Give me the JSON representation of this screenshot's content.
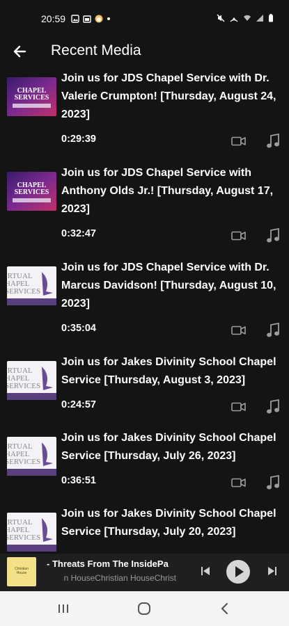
{
  "status": {
    "time": "20:59"
  },
  "header": {
    "title": "Recent Media",
    "back_icon": "arrow-left-icon"
  },
  "colors": {
    "background": "#141414",
    "icon_gray": "#9c9c9c",
    "player_bg": "#1f1f1f",
    "nav_bg": "#f4f4f4"
  },
  "items": [
    {
      "title": "Join us for JDS Chapel Service with Dr.\nValerie Crumpton! [Thursday, August 24,\n2023]",
      "duration": "0:29:39",
      "thumb_text": [
        "CHAPEL",
        "SERVICES"
      ],
      "thumb_style": "purple"
    },
    {
      "title": "Join us for JDS Chapel Service with\nAnthony Olds Jr.! [Thursday, August 17,\n2023]",
      "duration": "0:32:47",
      "thumb_text": [
        "CHAPEL",
        "SERVICES"
      ],
      "thumb_style": "purple"
    },
    {
      "title": "Join us for JDS Chapel Service with Dr.\nMarcus Davidson! [Thursday, August 10,\n2023]",
      "duration": "0:35:04",
      "thumb_text": [
        "IRTUAL",
        "HAPEL",
        "SERVICES"
      ],
      "thumb_style": "white"
    },
    {
      "title": "Join us for Jakes Divinity School Chapel\nService [Thursday, August 3, 2023]",
      "duration": "0:24:57",
      "thumb_text": [
        "IRTUAL",
        "HAPEL",
        "SERVICES"
      ],
      "thumb_style": "white"
    },
    {
      "title": "Join us for Jakes Divinity School Chapel\nService [Thursday, July 26, 2023]",
      "duration": "0:36:51",
      "thumb_text": [
        "IRTUAL",
        "HAPEL",
        "SERVICES"
      ],
      "thumb_style": "white"
    },
    {
      "title": "Join us for Jakes Divinity School Chapel\nService [Thursday, July 20, 2023]",
      "duration": "",
      "thumb_text": [
        "IRTUAL",
        "HAPEL",
        "SERVICES"
      ],
      "thumb_style": "white"
    }
  ],
  "player": {
    "title": "- Threats From The InsidePa",
    "subtitle": "n HouseChristian HouseChrist",
    "art_text": "Christian House"
  }
}
